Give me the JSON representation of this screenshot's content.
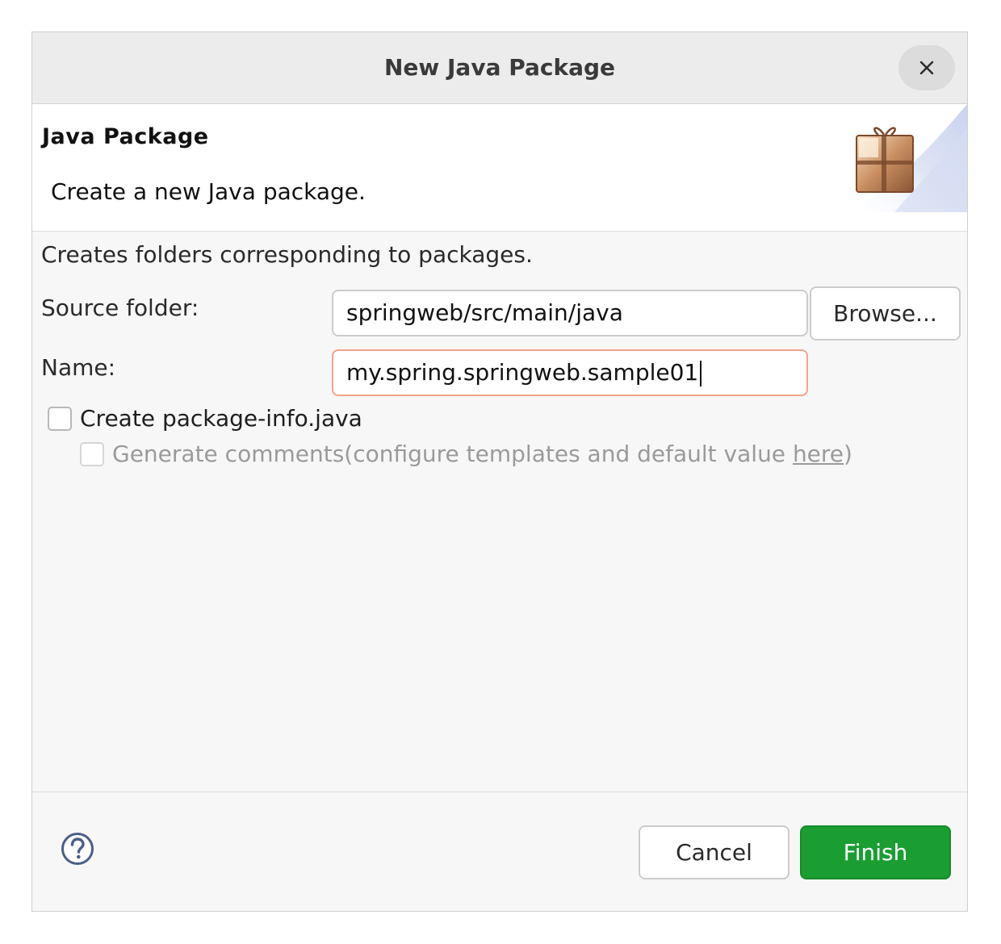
{
  "window": {
    "title": "New Java Package",
    "close_icon": "close-icon"
  },
  "header": {
    "title": "Java Package",
    "description": "Create a new Java package.",
    "icon": "package-icon"
  },
  "body": {
    "description": "Creates folders corresponding to packages.",
    "source_folder": {
      "label": "Source folder:",
      "value": "springweb/src/main/java",
      "browse_label": "Browse..."
    },
    "name": {
      "label": "Name:",
      "value": "my.spring.springweb.sample01"
    },
    "create_package_info": {
      "label": "Create package-info.java",
      "checked": false
    },
    "generate_comments": {
      "label": "Generate comments",
      "suffix_prefix": "(configure templates and default value ",
      "link": "here",
      "suffix_end": ")",
      "checked": false,
      "enabled": false
    }
  },
  "footer": {
    "help_icon": "help-icon",
    "cancel_label": "Cancel",
    "finish_label": "Finish"
  },
  "colors": {
    "finish_button": "#1a9e32",
    "focused_field_border": "#f0a48c"
  }
}
